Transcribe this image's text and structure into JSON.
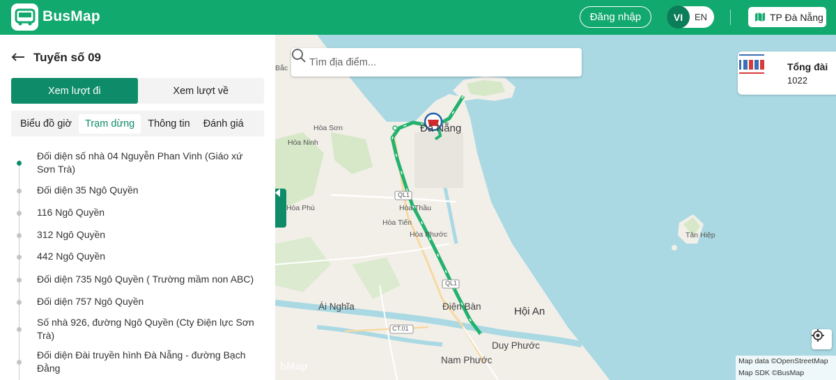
{
  "header": {
    "brand": "BusMap",
    "login_label": "Đăng nhập",
    "lang_active": "VI",
    "lang_other": "EN",
    "city_label": "TP Đà Nẵng",
    "brand_color": "#12a96f"
  },
  "sidebar": {
    "route_title": "Tuyến số 09",
    "direction_tabs": [
      {
        "label": "Xem lượt đi",
        "active": true
      },
      {
        "label": "Xem lượt về",
        "active": false
      }
    ],
    "sub_tabs": [
      {
        "label": "Biểu đồ giờ",
        "active": false
      },
      {
        "label": "Trạm dừng",
        "active": true
      },
      {
        "label": "Thông tin",
        "active": false
      },
      {
        "label": "Đánh giá",
        "active": false
      }
    ],
    "stops": [
      "Đối diện số nhà 04 Nguyễn Phan Vinh (Giáo xứ Sơn Trà)",
      "Đối diện 35 Ngô Quyền",
      "116 Ngô Quyền",
      "312 Ngô Quyền",
      "442 Ngô Quyền",
      "Đối diện 735 Ngô Quyền ( Trường mầm non ABC)",
      "Đối diện 757 Ngô Quyền",
      "Số nhà 926, đường Ngô Quyền (Cty Điện lực Sơn Trà)",
      "Đối diện Đài truyền hình Đà Nẵng - đường Bạch Đằng"
    ],
    "accent_color": "#0e8b68"
  },
  "map": {
    "search_placeholder": "Tìm địa điểm...",
    "hotline_title": "Tổng đài",
    "hotline_number": "1022",
    "attribution_1": "Map data ©OpenStreetMap",
    "attribution_2": "Map SDK ©BusMap",
    "watermark": "bMap",
    "labels": {
      "bac": "Bắc",
      "hoa_son": "Hòa Sơn",
      "hoa_ninh": "Hòa Ninh",
      "da_nang": "Đà Nẵng",
      "hoa_phu": "Hòa Phú",
      "hoa_thau": "Hòa Thầu",
      "hoa_tien": "Hòa Tiến",
      "hoa_phuoc": "Hòa Phước",
      "tan_hiep": "Tân Hiệp",
      "ai_nghia": "Ái Nghĩa",
      "dien_ban": "Điện Bàn",
      "hoi_an": "Hội An",
      "duy_phuoc": "Duy Phước",
      "nam_phuoc": "Nam Phước",
      "ql1": "QL1",
      "ql1b": "QL1",
      "ct01": "CT.01"
    },
    "route_color": "#23b26d"
  }
}
